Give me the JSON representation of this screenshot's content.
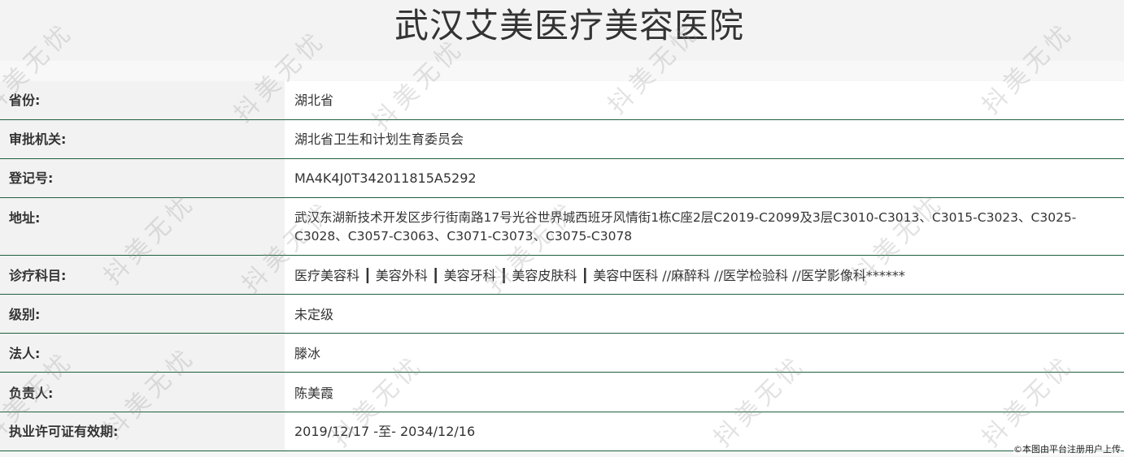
{
  "title": "武汉艾美医疗美容医院",
  "rows": [
    {
      "label": "省份:",
      "value": "湖北省"
    },
    {
      "label": "审批机关:",
      "value": "湖北省卫生和计划生育委员会"
    },
    {
      "label": "登记号:",
      "value": "MA4K4J0T342011815A5292"
    },
    {
      "label": "地址:",
      "value": "武汉东湖新技术开发区步行街南路17号光谷世界城西班牙风情街1栋C座2层C2019-C2099及3层C3010-C3013、C3015-C3023、C3025-C3028、C3057-C3063、C3071-C3073、C3075-C3078"
    },
    {
      "label": "诊疗科目:",
      "value": "医疗美容科 ┃ 美容外科 ┃ 美容牙科 ┃ 美容皮肤科 ┃ 美容中医科 //麻醉科 //医学检验科 //医学影像科******"
    },
    {
      "label": "级别:",
      "value": "未定级"
    },
    {
      "label": "法人:",
      "value": "滕冰"
    },
    {
      "label": "负责人:",
      "value": "陈美霞"
    },
    {
      "label": "执业许可证有效期:",
      "value": "2019/12/17 -至- 2034/12/16"
    }
  ],
  "watermark_text": "抖美无忧",
  "footer_credit": "©本图由平台注册用户上传"
}
